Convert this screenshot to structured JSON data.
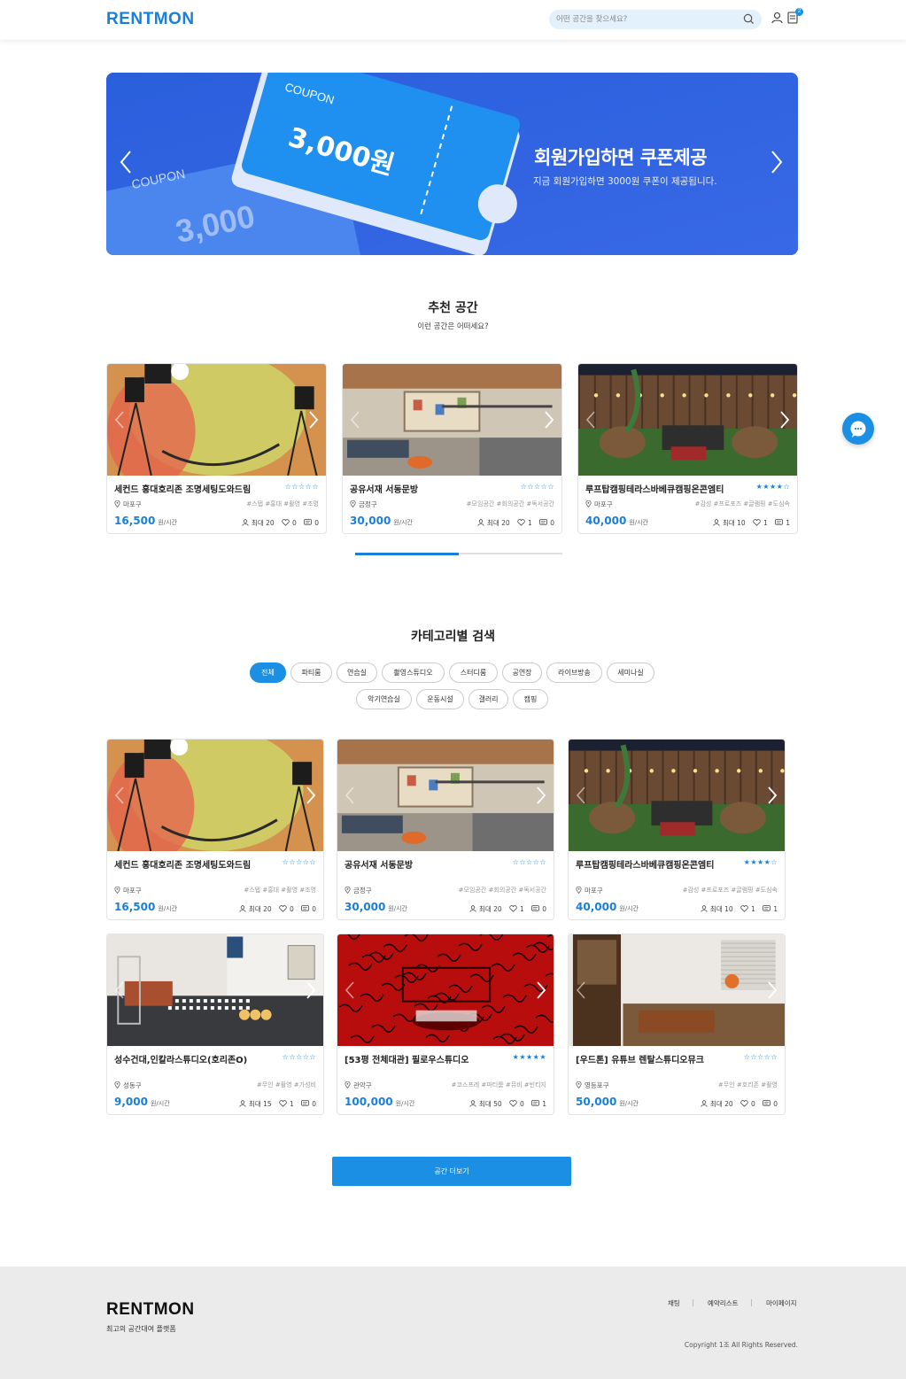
{
  "header": {
    "logo": "RENTMON",
    "search_placeholder": "어떤 공간을 찾으세요?",
    "cart_badge": "2"
  },
  "banner": {
    "title": "회원가입하면 쿠폰제공",
    "subtitle": "지금 회원가입하면 3000원 쿠폰이 제공됩니다.",
    "coupon_label": "COUPON",
    "coupon_amount": "3,000원",
    "coupon_back_label": "COUPON",
    "coupon_back_amount": "3,000"
  },
  "recommended": {
    "title": "추천 공간",
    "subtitle": "이런 공간은 어떠세요?",
    "scroll_progress": 0.5,
    "cards": [
      {
        "name": "세컨드 홍대호리존 조명세팅도와드림",
        "stars": "☆☆☆☆☆",
        "location": "마포구",
        "tags": "#스탭 #홍대 #촬영 #조명",
        "price": "16,500",
        "unit": "원/시간",
        "capacity": "최대 20",
        "likes": "0",
        "reviews": "0"
      },
      {
        "name": "공유서재 서동문방",
        "stars": "☆☆☆☆☆",
        "location": "금정구",
        "tags": "#모임공간 #회의공간 #독서공간",
        "price": "30,000",
        "unit": "원/시간",
        "capacity": "최대 20",
        "likes": "1",
        "reviews": "0"
      },
      {
        "name": "루프탑캠핑테라스바베큐캠핑온콘엠티",
        "stars": "★★★★☆",
        "location": "마포구",
        "tags": "#감성 #프로포즈 #글램핑 #도심속",
        "price": "40,000",
        "unit": "원/시간",
        "capacity": "최대 10",
        "likes": "1",
        "reviews": "1"
      }
    ]
  },
  "category": {
    "title": "카테고리별 검색",
    "chips": [
      "전체",
      "파티룸",
      "연습실",
      "촬영스튜디오",
      "스터디룸",
      "공연장",
      "라이브방송",
      "세미나실",
      "악기연습실",
      "운동시설",
      "갤러리",
      "캠핑"
    ],
    "active": "전체",
    "cards": [
      {
        "name": "세컨드 홍대호리존 조명세팅도와드림",
        "stars": "☆☆☆☆☆",
        "location": "마포구",
        "tags": "#스탭 #홍대 #촬영 #조명",
        "price": "16,500",
        "unit": "원/시간",
        "capacity": "최대 20",
        "likes": "0",
        "reviews": "0"
      },
      {
        "name": "공유서재 서동문방",
        "stars": "☆☆☆☆☆",
        "location": "금정구",
        "tags": "#모임공간 #회의공간 #독서공간",
        "price": "30,000",
        "unit": "원/시간",
        "capacity": "최대 20",
        "likes": "1",
        "reviews": "0"
      },
      {
        "name": "루프탑캠핑테라스바베큐캠핑온콘엠티",
        "stars": "★★★★☆",
        "location": "마포구",
        "tags": "#감성 #프로포즈 #글램핑 #도심속",
        "price": "40,000",
        "unit": "원/시간",
        "capacity": "최대 10",
        "likes": "1",
        "reviews": "1"
      },
      {
        "name": "성수건대,인칼라스튜디오(호리존O)",
        "stars": "☆☆☆☆☆",
        "location": "성동구",
        "tags": "#무인 #촬영 #가성비",
        "price": "9,000",
        "unit": "원/시간",
        "capacity": "최대 15",
        "likes": "1",
        "reviews": "0"
      },
      {
        "name": "[53평 전체대관] 필로우스튜디오",
        "stars": "★★★★★",
        "location": "관악구",
        "tags": "#코스프레 #파티룸 #뮤비 #빈티지",
        "price": "100,000",
        "unit": "원/시간",
        "capacity": "최대 50",
        "likes": "0",
        "reviews": "1"
      },
      {
        "name": "[우드톤] 유튜브 렌탈스튜디오뮤크",
        "stars": "☆☆☆☆☆",
        "location": "영등포구",
        "tags": "#무인 #호리존 #촬영",
        "price": "50,000",
        "unit": "원/시간",
        "capacity": "최대 20",
        "likes": "0",
        "reviews": "0"
      }
    ],
    "more_button": "공간 더보기"
  },
  "footer": {
    "logo": "RENTMON",
    "tagline": "최고의 공간대여 플랫폼",
    "links": [
      "채팅",
      "예약리스트",
      "마이페이지"
    ],
    "copyright": "Copyright 1조 All Rights Reserved."
  }
}
